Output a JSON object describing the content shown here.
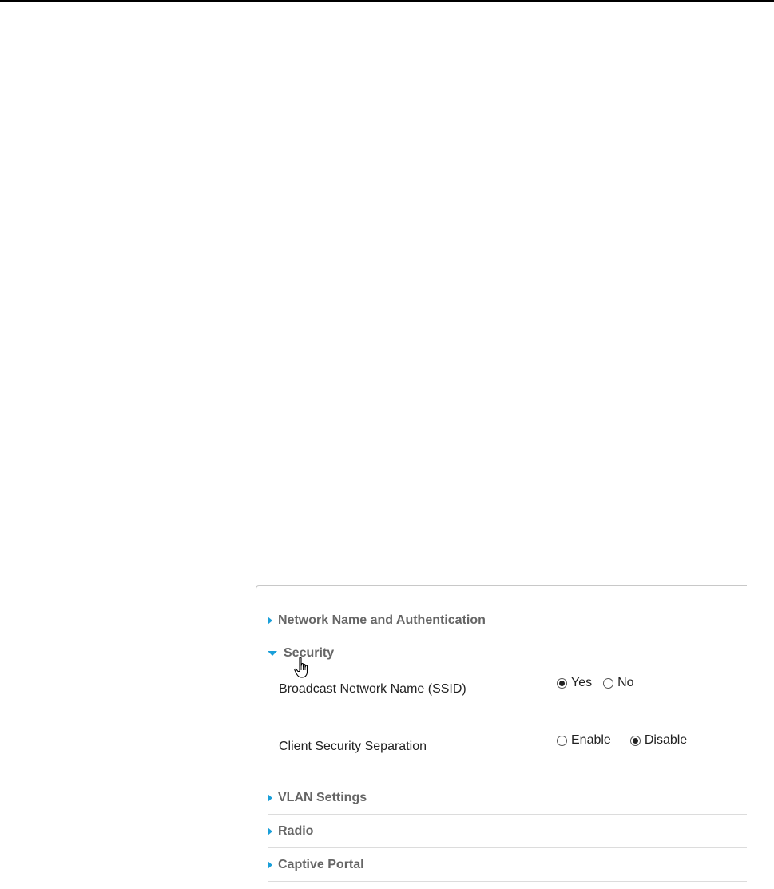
{
  "panel": {
    "sections": {
      "network_name": {
        "title": "Network Name and Authentication",
        "expanded": false
      },
      "security": {
        "title": "Security",
        "expanded": true,
        "broadcast_ssid": {
          "label": "Broadcast Network Name (SSID)",
          "options": [
            "Yes",
            "No"
          ],
          "selected": "Yes"
        },
        "client_separation": {
          "label": "Client Security Separation",
          "options": [
            "Enable",
            "Disable"
          ],
          "selected": "Disable"
        }
      },
      "vlan": {
        "title": "VLAN Settings",
        "expanded": false
      },
      "radio": {
        "title": "Radio",
        "expanded": false
      },
      "captive_portal": {
        "title": "Captive Portal",
        "expanded": false
      }
    }
  },
  "colors": {
    "accent_triangle": "#1a9fd9",
    "section_title": "#666666",
    "divider": "#dcdcdc"
  },
  "icons": {
    "collapsed": "triangle-right-icon",
    "expanded": "triangle-down-icon",
    "pointer": "hand-pointer-cursor-icon"
  }
}
